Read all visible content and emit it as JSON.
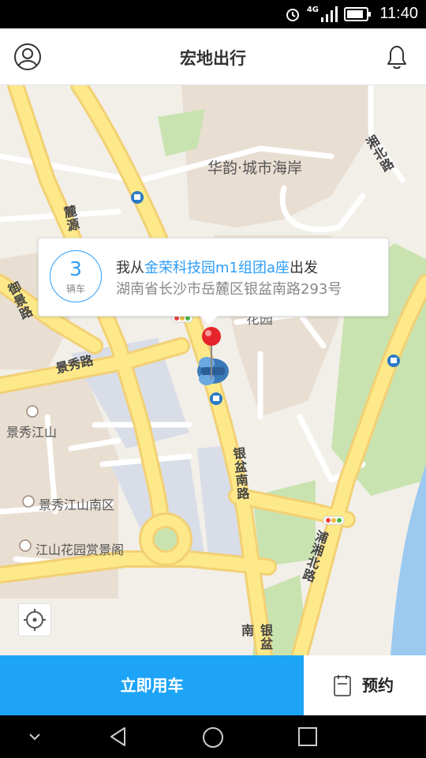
{
  "status_bar": {
    "time": "11:40",
    "network": "4G"
  },
  "header": {
    "title": "宏地出行",
    "left_icon": "profile-icon",
    "right_icon": "bell-icon"
  },
  "map": {
    "poi": {
      "huayun": "华韵·城市海岸",
      "jingxiu": "景秀江山",
      "jingxiu_south": "景秀江山南区",
      "jiangshan_garden": "江山花园赏景阁",
      "partial": "花园"
    },
    "roads": {
      "lushan": "麓源",
      "yujing": "御景路",
      "jingxiu_road": "景秀路",
      "yinpen_south": "银盆南路",
      "yinpen_south_bottom": "银盆南",
      "puxiang_north": "浦湘北路",
      "xiangjiang_north": "湘北路"
    }
  },
  "info_bubble": {
    "car_count": "3",
    "car_unit": "辆车",
    "prefix": "我从",
    "place": "金荣科技园m1组团a座",
    "suffix": "出发",
    "address": "湖南省长沙市岳麓区银盆南路293号"
  },
  "actions": {
    "now_label": "立即用车",
    "book_label": "预约"
  },
  "colors": {
    "accent": "#1ea4f6",
    "highlight": "#2d9df7",
    "road": "#fde989",
    "road_edge": "#f2d074",
    "block": "#e9ded2",
    "green": "#c9e3b0",
    "water": "#9bc9f0"
  }
}
